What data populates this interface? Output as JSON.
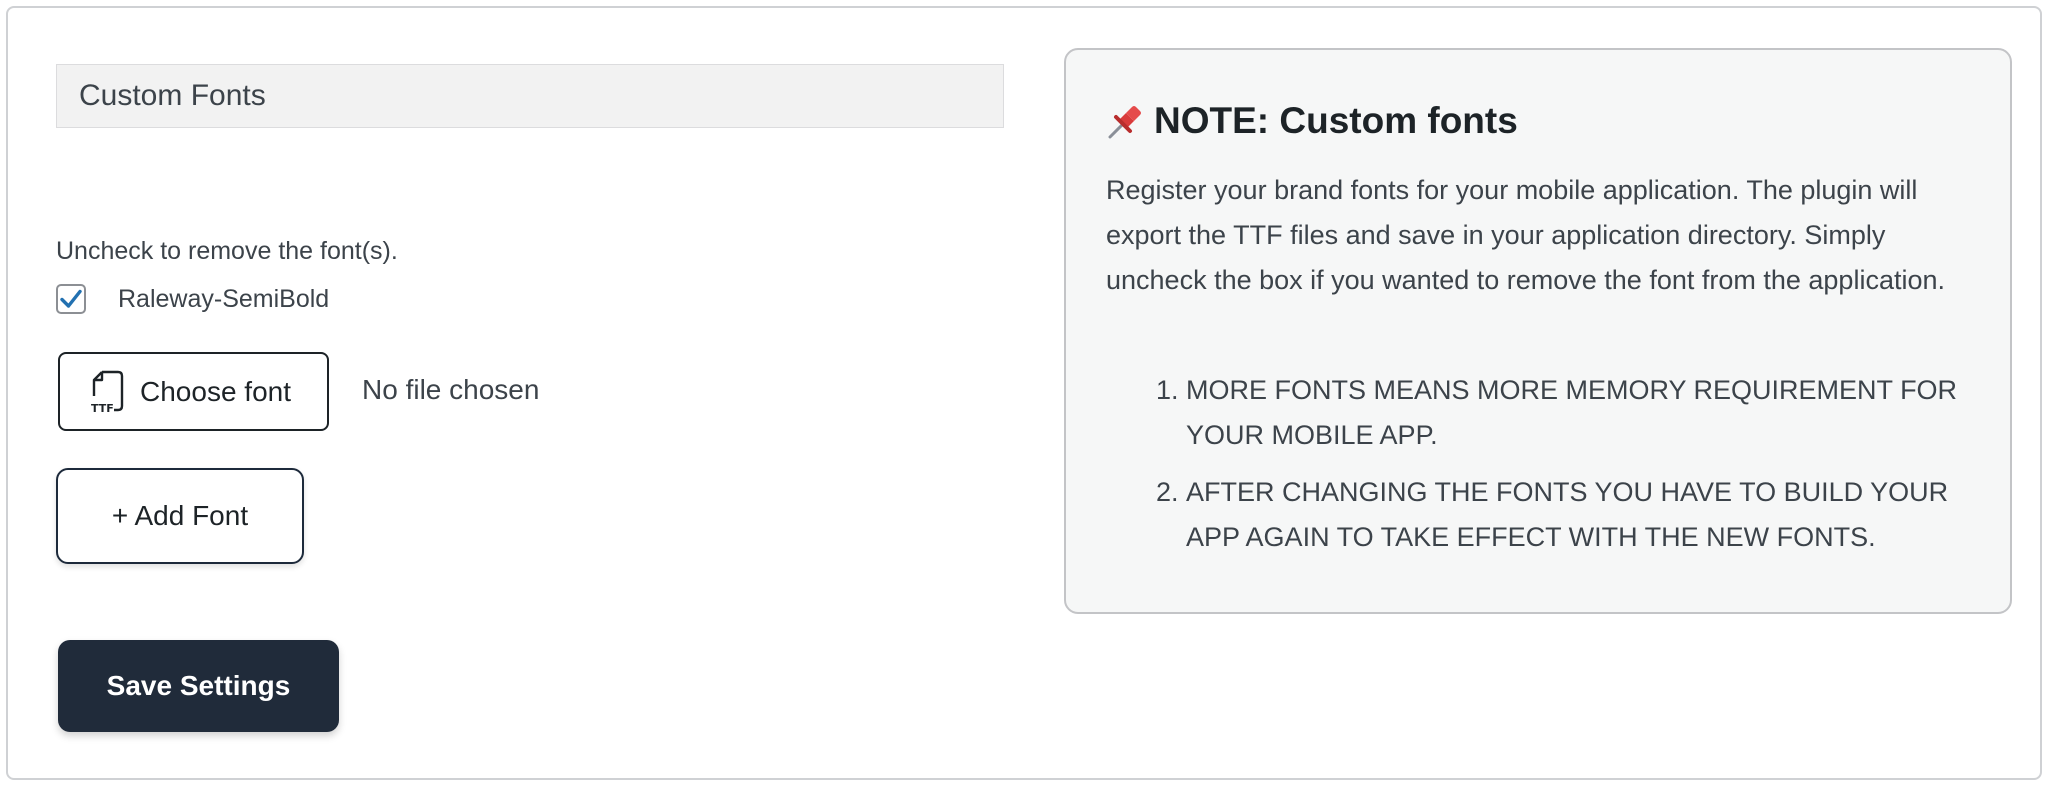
{
  "section": {
    "title": "Custom Fonts"
  },
  "fonts": {
    "hint": "Uncheck to remove the font(s).",
    "items": [
      {
        "name": "Raleway-SemiBold",
        "checked": true
      }
    ]
  },
  "file_input": {
    "button_label": "Choose font",
    "icon": "ttf-file-icon",
    "status": "No file chosen"
  },
  "actions": {
    "add_font": "+ Add Font",
    "save": "Save Settings"
  },
  "note": {
    "icon": "pushpin-icon",
    "title": "NOTE: Custom fonts",
    "body": "Register your brand fonts for your mobile application. The plugin will export the TTF files and save in your application directory. Simply uncheck the box if you wanted to remove the font from the application.",
    "items": [
      "MORE FONTS MEANS MORE MEMORY REQUIREMENT FOR YOUR MOBILE APP.",
      "AFTER CHANGING THE FONTS YOU HAVE TO BUILD YOUR APP AGAIN TO TAKE EFFECT WITH THE NEW FONTS."
    ]
  },
  "colors": {
    "primary_button": "#202b3a",
    "checkmark": "#2271b1",
    "note_background": "#f6f7f7"
  }
}
